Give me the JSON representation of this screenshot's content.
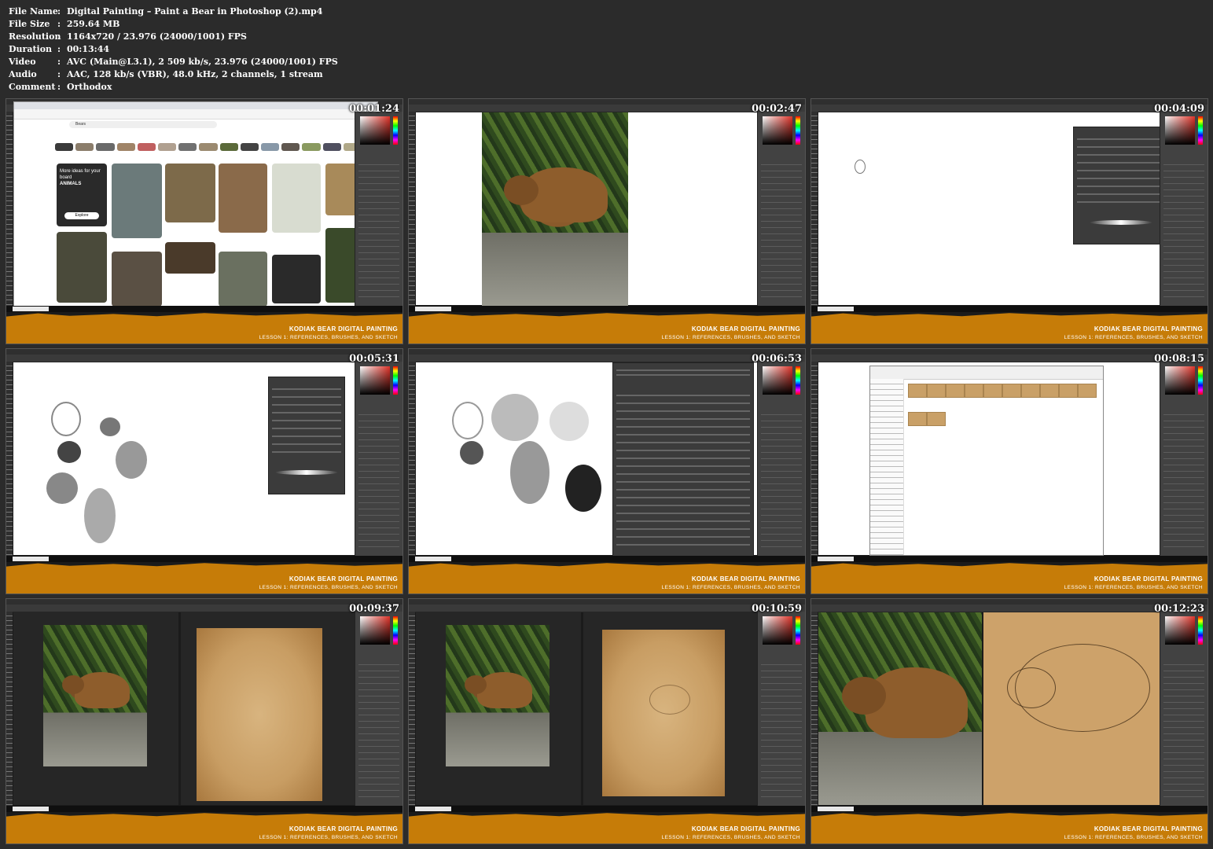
{
  "file_info": [
    {
      "key": "File Name",
      "value": "Digital Painting – Paint a Bear in Photoshop (2).mp4"
    },
    {
      "key": "File Size",
      "value": "259.64 MB"
    },
    {
      "key": "Resolution",
      "value": "1164x720 / 23.976 (24000/1001) FPS"
    },
    {
      "key": "Duration",
      "value": "00:13:44"
    },
    {
      "key": "Video",
      "value": "AVC (Main@L3.1), 2 509 kb/s, 23.976 (24000/1001) FPS"
    },
    {
      "key": "Audio",
      "value": "AAC, 128 kb/s (VBR), 48.0 kHz, 2 channels, 1 stream"
    },
    {
      "key": "Comment",
      "value": "Orthodox"
    }
  ],
  "info_separator": ":",
  "banner": {
    "title": "KODIAK BEAR DIGITAL PAINTING",
    "subtitle": "LESSON 1: REFERENCES, BRUSHES, AND SKETCH"
  },
  "thumbnails": [
    {
      "timecode": "00:01:24",
      "scene": "browser-references"
    },
    {
      "timecode": "00:02:47",
      "scene": "bear-photo"
    },
    {
      "timecode": "00:04:09",
      "scene": "brush-settings"
    },
    {
      "timecode": "00:05:31",
      "scene": "brush-strokes"
    },
    {
      "timecode": "00:06:53",
      "scene": "brush-library"
    },
    {
      "timecode": "00:08:15",
      "scene": "file-explorer"
    },
    {
      "timecode": "00:09:37",
      "scene": "split-canvas"
    },
    {
      "timecode": "00:10:59",
      "scene": "split-canvas-sketch"
    },
    {
      "timecode": "00:12:23",
      "scene": "zoomed-sketch"
    }
  ],
  "browser": {
    "promo_heading": "More ideas for your board",
    "promo_board": "ANIMALS",
    "promo_button": "Explore",
    "search": "Bears"
  },
  "colors": {
    "banner": "#c67c08",
    "background": "#2b2b2b",
    "photoshop_ui": "#424242"
  }
}
